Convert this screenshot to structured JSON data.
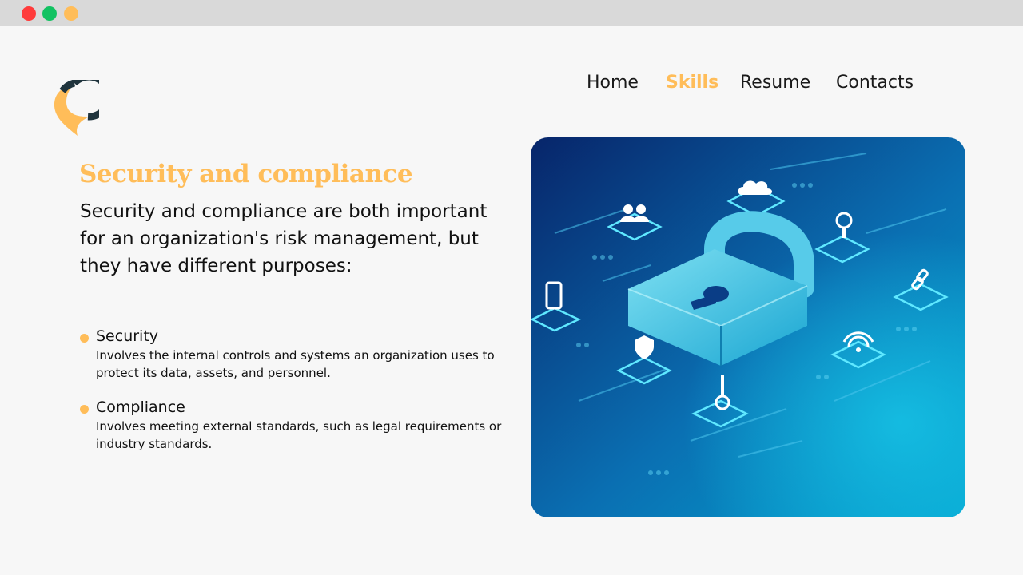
{
  "window": {
    "controls": [
      "close",
      "maximize",
      "minimize"
    ]
  },
  "logo": {
    "icon": "location-pin-logo-icon"
  },
  "nav": {
    "items": [
      {
        "label": "Home"
      },
      {
        "label": "Skills",
        "active": true
      },
      {
        "label": "Resume"
      },
      {
        "label": "Contacts"
      }
    ]
  },
  "content": {
    "heading": "Security and compliance",
    "intro": "Security and compliance are both important for an organization's risk management, but they have different purposes:",
    "bullets": [
      {
        "title": "Security",
        "description": "Involves the internal controls and systems an organization uses to  protect its data, assets, and personnel."
      },
      {
        "title": "Compliance",
        "description": "Involves meeting external standards, such as legal requirements or industry standards."
      }
    ]
  },
  "hero": {
    "icon": "padlock-cybersecurity-illustration"
  },
  "colors": {
    "accent": "#ffbd59",
    "titlebar": "#d9d9d9",
    "background": "#f7f7f7",
    "close": "#ff3b3b",
    "maximize": "#12c262",
    "minimize": "#ffbd59"
  }
}
